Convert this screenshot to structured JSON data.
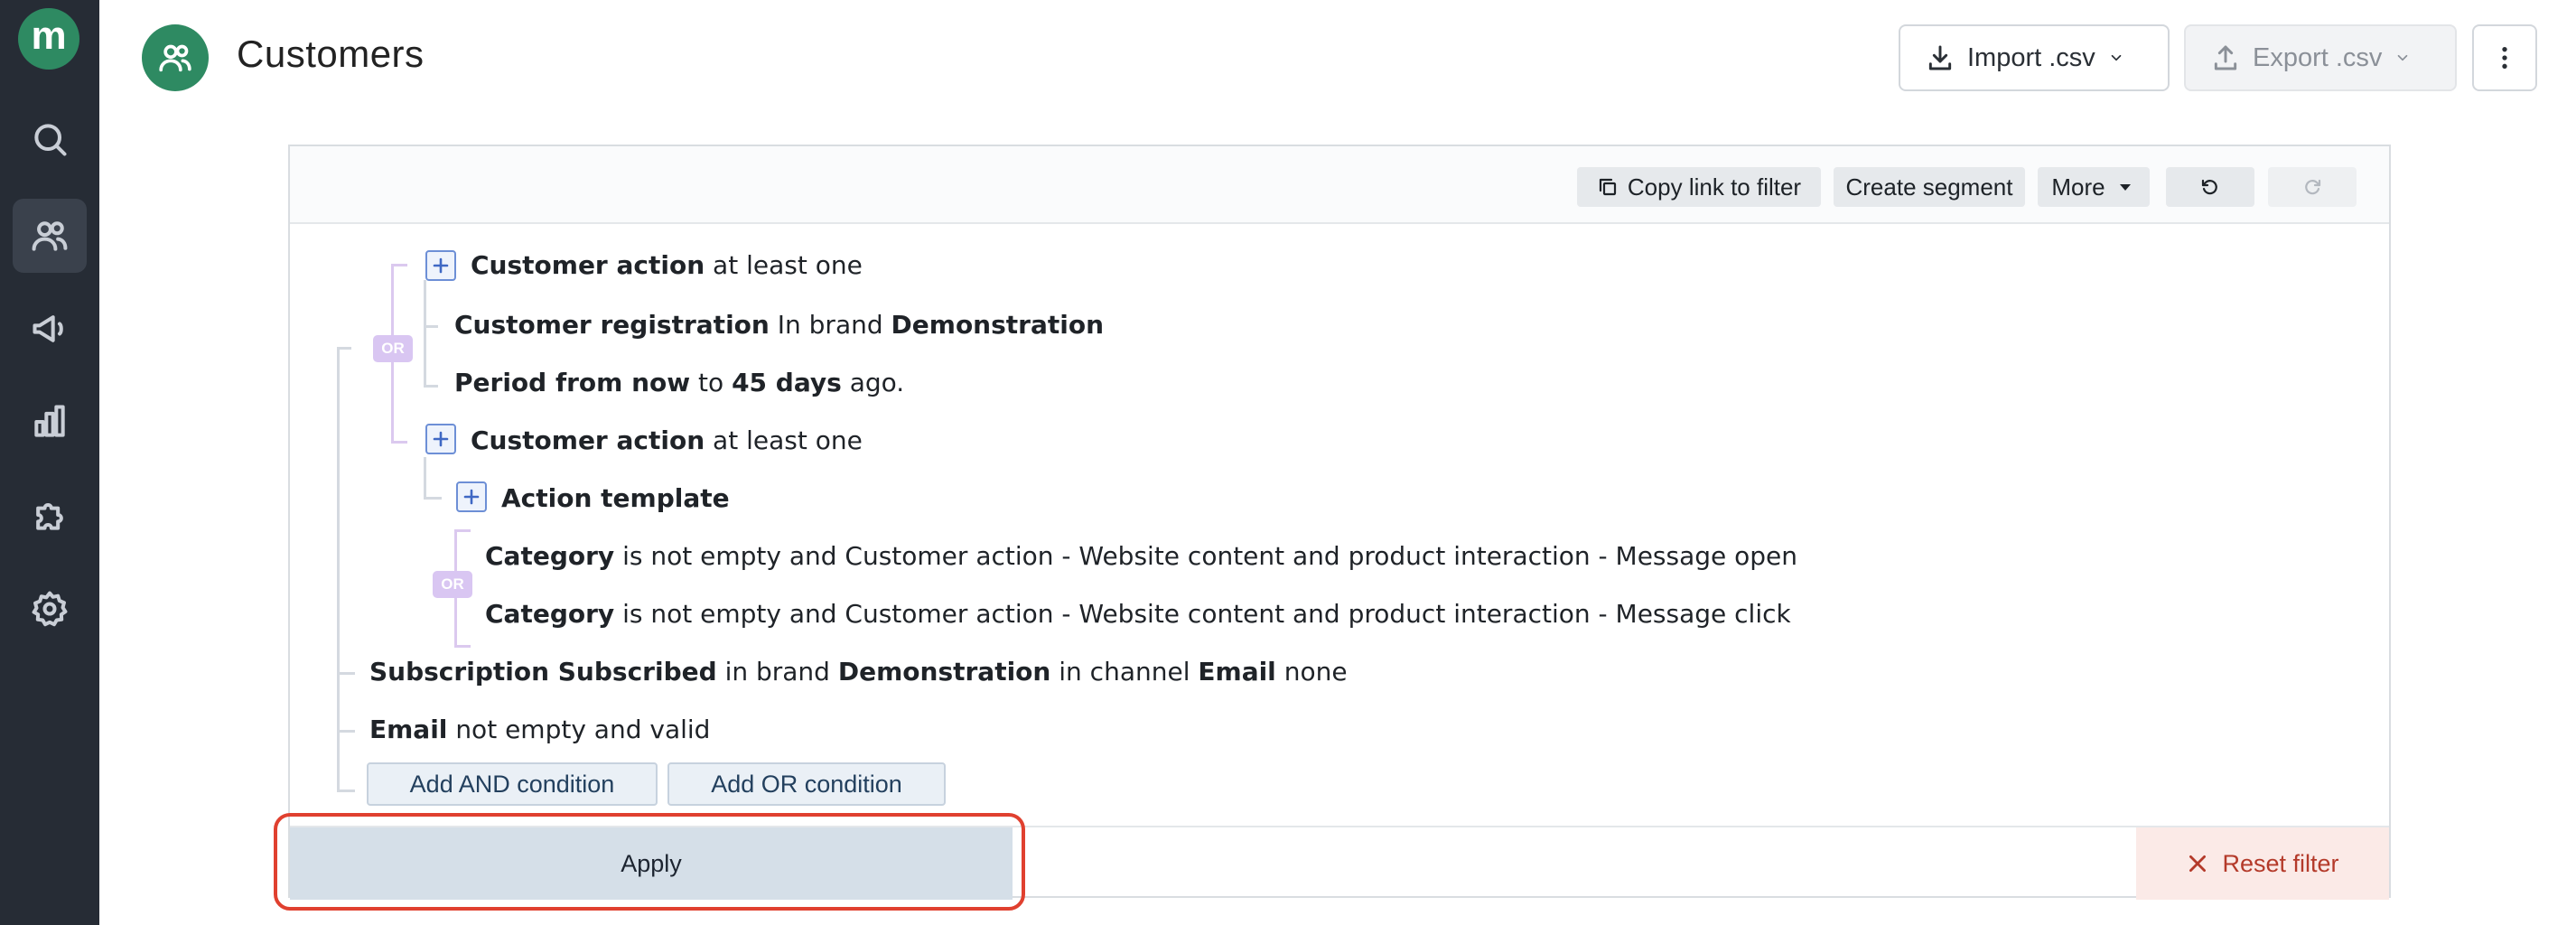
{
  "sidebar": {
    "logo_letter": "m",
    "items": [
      {
        "icon": "search-icon"
      },
      {
        "icon": "users-icon",
        "active": true
      },
      {
        "icon": "megaphone-icon"
      },
      {
        "icon": "bar-chart-icon"
      },
      {
        "icon": "puzzle-icon"
      },
      {
        "icon": "gear-icon"
      }
    ]
  },
  "header": {
    "title": "Customers",
    "icon": "users-icon",
    "import_label": "Import .csv",
    "export_label": "Export .csv"
  },
  "toolbar": {
    "copy_link": "Copy link to filter",
    "create_segment": "Create segment",
    "more": "More"
  },
  "conditions": {
    "c1": {
      "bold": "Customer action",
      "rest": "at least one"
    },
    "c2": {
      "bold1": "Customer registration",
      "mid": "In brand",
      "bold2": "Demonstration"
    },
    "c3": {
      "bold1": "Period from now",
      "mid": "to",
      "bold2": "45 days",
      "rest": "ago."
    },
    "c4": {
      "bold": "Customer action",
      "rest": "at least one"
    },
    "c5": {
      "bold": "Action template"
    },
    "c6": {
      "bold": "Category",
      "rest": "is not empty and Customer action - Website content and product interaction - Message open"
    },
    "c7": {
      "bold": "Category",
      "rest": "is not empty and Customer action - Website content and product interaction - Message click"
    },
    "c8": {
      "bold1": "Subscription Subscribed",
      "mid1": "in brand",
      "bold2": "Demonstration",
      "mid2": "in channel",
      "bold3": "Email",
      "rest": "none"
    },
    "c9": {
      "bold": "Email",
      "rest": "not empty and valid"
    },
    "or_label": "OR"
  },
  "actions": {
    "add_and": "Add AND condition",
    "add_or": "Add OR condition",
    "apply": "Apply",
    "reset": "Reset filter"
  },
  "colors": {
    "brand": "#2e8a62",
    "sidebar": "#262c35",
    "highlight": "#e0402f",
    "reset": "#b43a2a"
  }
}
